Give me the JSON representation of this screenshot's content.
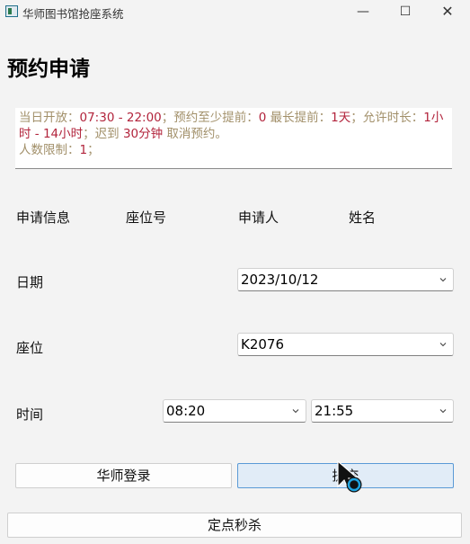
{
  "window": {
    "title": "华师图书馆抢座系统",
    "controls": {
      "minimize": "—",
      "maximize": "☐",
      "close": "✕"
    }
  },
  "page_title": "预约申请",
  "notice": {
    "open_label": "当日开放：",
    "open_time": "07:30 - 22:00",
    "sep1": "；预约至少提前：",
    "min_advance": "0",
    "max_label": " 最长提前：",
    "max_advance": "1天",
    "allow_label": "；允许时长：",
    "duration": "1小时 - 14小时",
    "late_label": "；迟到 ",
    "late_minutes": "30分钟",
    "cancel_label": " 取消预约。",
    "limit_label": "人数限制：",
    "limit_value": "1",
    "limit_end": "；"
  },
  "headers": {
    "info": "申请信息",
    "seat_no": "座位号",
    "applicant": "申请人",
    "name": "姓名"
  },
  "form": {
    "date_label": "日期",
    "date_value": "2023/10/12",
    "seat_label": "座位",
    "seat_value": "K2076",
    "time_label": "时间",
    "start_time": "08:20",
    "end_time": "21:55"
  },
  "buttons": {
    "login": "华师登录",
    "submit": "提交",
    "seckill": "定点秒杀"
  }
}
